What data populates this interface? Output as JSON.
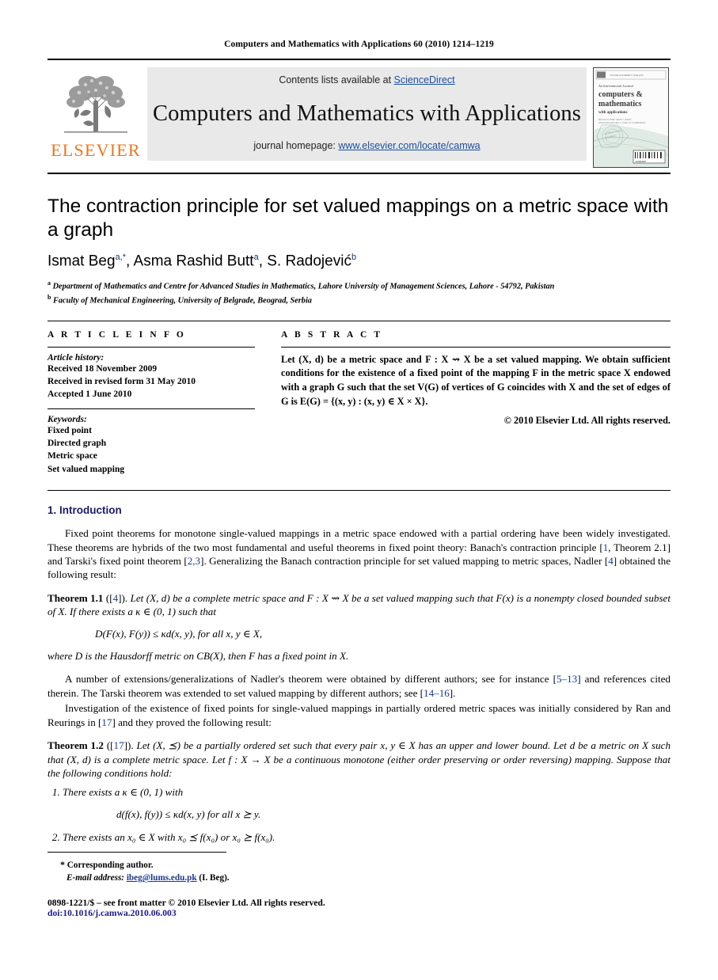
{
  "running_head": "Computers and Mathematics with Applications 60 (2010) 1214–1219",
  "masthead": {
    "publisher_logo_text": "ELSEVIER",
    "contents_prefix": "Contents lists available at ",
    "contents_link": "ScienceDirect",
    "journal_name": "Computers and Mathematics with Applications",
    "homepage_prefix": "journal homepage: ",
    "homepage_url": "www.elsevier.com/locate/camwa",
    "cover": {
      "kicker": "An International Journal",
      "title_line1": "computers &",
      "title_line2": "mathematics",
      "title_line3": "with applications"
    }
  },
  "article": {
    "title": "The contraction principle for set valued mappings on a metric space with a graph",
    "authors_html": "Ismat Beg <sup>a,*</sup>, Asma Rashid Butt <sup>a</sup>, S. Radojević <sup>b</sup>",
    "affiliations": [
      {
        "marker": "a",
        "text": "Department of Mathematics and Centre for Advanced Studies in Mathematics, Lahore University of Management Sciences, Lahore - 54792, Pakistan"
      },
      {
        "marker": "b",
        "text": "Faculty of Mechanical Engineering, University of Belgrade, Beograd, Serbia"
      }
    ]
  },
  "info": {
    "heading": "A R T I C L E   I N F O",
    "history_heading": "Article history:",
    "history": [
      "Received 18 November 2009",
      "Received in revised form 31 May 2010",
      "Accepted 1 June 2010"
    ],
    "keywords_heading": "Keywords:",
    "keywords": [
      "Fixed point",
      "Directed graph",
      "Metric space",
      "Set valued mapping"
    ]
  },
  "abstract": {
    "heading": "A B S T R A C T",
    "text": "Let (X, d) be a metric space and F : X ⇝ X be a set valued mapping. We obtain sufficient conditions for the existence of a fixed point of the mapping F in the metric space X endowed with a graph G such that the set V(G) of vertices of G coincides with X and the set of edges of G is E(G) = {(x, y) : (x, y) ∈ X × X}.",
    "copyright": "© 2010 Elsevier Ltd. All rights reserved."
  },
  "sections": {
    "intro_number": "1.",
    "intro_title": "Introduction",
    "intro_paragraph_1": "Fixed point theorems for monotone single-valued mappings in a metric space endowed with a partial ordering have been widely investigated. These theorems are hybrids of the two most fundamental and useful theorems in fixed point theory: Banach's contraction principle [1, Theorem 2.1] and Tarski's fixed point theorem [2,3]. Generalizing the Banach contraction principle for set valued mapping to metric spaces, Nadler [4] obtained the following result:",
    "theorem_1_1": {
      "name": "Theorem 1.1",
      "cite": "([4]).",
      "statement": "Let (X, d) be a complete metric space and F : X ⇝ X be a set valued mapping such that F(x) is a nonempty closed bounded subset of X. If there exists a κ ∈ (0, 1) such that",
      "equation": "D(F(x), F(y)) ≤ κd(x, y),     for all x, y ∈ X,",
      "tail": "where D is the Hausdorff metric on CB(X), then F has a fixed point in X."
    },
    "paragraph_2": "A number of extensions/generalizations of Nadler's theorem were obtained by different authors; see for instance [5–13] and references cited therein. The Tarski theorem was extended to set valued mapping by different authors; see [14–16].",
    "paragraph_3": "Investigation of the existence of fixed points for single-valued mappings in partially ordered metric spaces was initially considered by Ran and Reurings in [17] and they proved the following result:",
    "theorem_1_2": {
      "name": "Theorem 1.2",
      "cite": "([17]).",
      "statement": "Let (X, ⪯) be a partially ordered set such that every pair x, y ∈ X has an upper and lower bound. Let d be a metric on X such that (X, d) is a complete metric space. Let f : X → X be a continuous monotone (either order preserving or order reversing) mapping. Suppose that the following conditions hold:",
      "conditions": [
        {
          "lead": "There exists a κ ∈ (0, 1) with",
          "equation": "d(f(x), f(y)) ≤ κd(x, y)   for all x ⪰ y."
        },
        {
          "lead": "There exists an x₀ ∈ X with x₀ ⪯ f(x₀) or x₀ ⪰ f(x₀).",
          "equation": ""
        }
      ]
    }
  },
  "footnotes": {
    "corresponding_marker": "*",
    "corresponding_text": "Corresponding author.",
    "email_label": "E-mail address:",
    "email": "ibeg@lums.edu.pk",
    "email_owner": "(I. Beg).",
    "issn_line": "0898-1221/$ – see front matter © 2010 Elsevier Ltd. All rights reserved.",
    "doi_line": "doi:10.1016/j.camwa.2010.06.003"
  },
  "colors": {
    "link_blue": "#1a4fa0",
    "ref_blue": "#1a3a8f",
    "elsevier_orange": "#E87722",
    "masthead_gray": "#e9e9e9"
  }
}
